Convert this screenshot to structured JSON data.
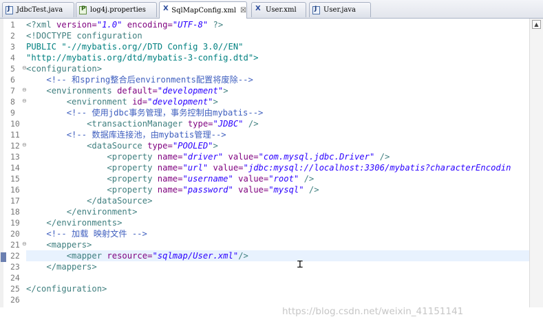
{
  "tabs": [
    {
      "label": "JdbcTest.java",
      "icon": "java-file-icon"
    },
    {
      "label": "log4j.properties",
      "icon": "properties-file-icon"
    },
    {
      "label": "SqlMapConfig.xml",
      "icon": "xml-file-icon",
      "active": true,
      "close": "☒"
    },
    {
      "label": "User.xml",
      "icon": "xml-file-icon"
    },
    {
      "label": "User.java",
      "icon": "java-file-icon"
    }
  ],
  "line_numbers": [
    "1",
    "2",
    "3",
    "4",
    "5",
    "6",
    "7",
    "8",
    "9",
    "10",
    "11",
    "12",
    "13",
    "14",
    "15",
    "16",
    "17",
    "18",
    "19",
    "20",
    "21",
    "22",
    "23",
    "24",
    "25",
    "26"
  ],
  "code": {
    "l1": [
      "<?xml ",
      "version=",
      "\"1.0\"",
      " encoding=",
      "\"UTF-8\"",
      " ?>"
    ],
    "l2": "<!DOCTYPE configuration",
    "l3": [
      "PUBLIC ",
      "\"-//mybatis.org//DTD Config 3.0//EN\""
    ],
    "l4": "\"http://mybatis.org/dtd/mybatis-3-config.dtd\">",
    "l5": "<configuration>",
    "l6": "<!-- 和spring整合后environments配置将废除-->",
    "l7": [
      "<environments ",
      "default=",
      "\"development\"",
      ">"
    ],
    "l8": [
      "<environment ",
      "id=",
      "\"development\"",
      ">"
    ],
    "l9": "<!-- 使用jdbc事务管理，事务控制由mybatis-->",
    "l10": [
      "<transactionManager ",
      "type=",
      "\"JDBC\"",
      " />"
    ],
    "l11": "<!-- 数据库连接池，由mybatis管理-->",
    "l12": [
      "<dataSource ",
      "type=",
      "\"POOLED\"",
      ">"
    ],
    "l13": [
      "<property ",
      "name=",
      "\"driver\"",
      " value=",
      "\"com.mysql.jdbc.Driver\"",
      " />"
    ],
    "l14": [
      "<property ",
      "name=",
      "\"url\"",
      " value=",
      "\"jdbc:mysql://localhost:3306/mybatis?characterEncodin"
    ],
    "l15": [
      "<property ",
      "name=",
      "\"username\"",
      " value=",
      "\"root\"",
      " />"
    ],
    "l16": [
      "<property ",
      "name=",
      "\"password\"",
      " value=",
      "\"mysql\"",
      " />"
    ],
    "l17": "</dataSource>",
    "l18": "</environment>",
    "l19": "</environments>",
    "l20": "<!-- 加载 映射文件 -->",
    "l21": "<mappers>",
    "l22": [
      "<mapper ",
      "resource=",
      "\"sqlmap/User.xml\"",
      "/>"
    ],
    "l23": "</mappers>",
    "l24": "",
    "l25": "</configuration>",
    "l26": ""
  },
  "watermark": "https://blog.csdn.net/weixin_41151141",
  "colors": {
    "tag": "#3f7f7f",
    "attribute": "#7f007f",
    "value": "#2a00ff",
    "comment": "#3f5fbf",
    "current_line": "#e8f2fe"
  }
}
